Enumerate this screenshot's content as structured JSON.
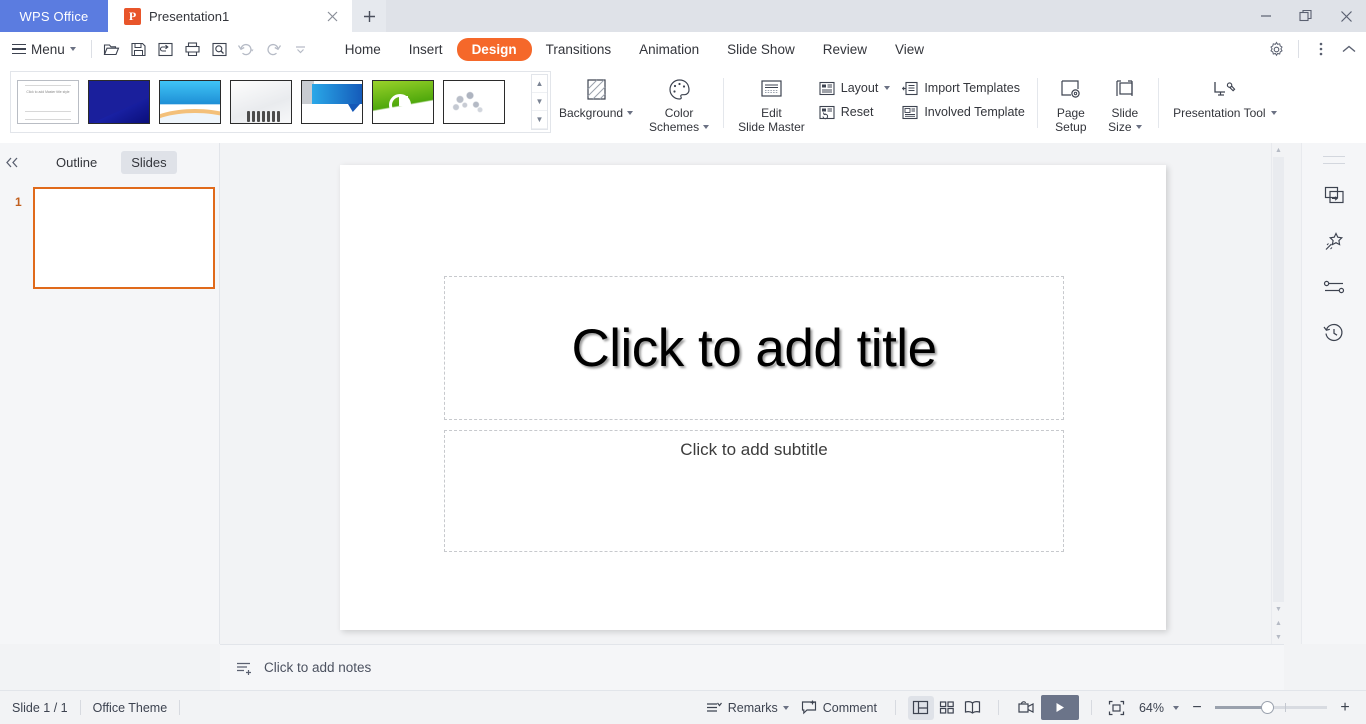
{
  "titlebar": {
    "app_name": "WPS Office",
    "doc_tab": {
      "title": "Presentation1",
      "icon": "powerpoint-icon",
      "icon_glyph": "P",
      "close_icon": "close-icon"
    },
    "new_tab_label": "+",
    "window_controls": {
      "minimize": "minimize-icon",
      "restore": "restore-icon",
      "close": "close-icon"
    }
  },
  "menubar": {
    "menu_label": "Menu",
    "quick_access": [
      "open-icon",
      "save-icon",
      "save-as-icon",
      "print-icon",
      "print-preview-icon",
      "undo-icon",
      "redo-icon",
      "customize-qat-icon"
    ],
    "tabs": [
      {
        "label": "Home",
        "active": false
      },
      {
        "label": "Insert",
        "active": false
      },
      {
        "label": "Design",
        "active": true
      },
      {
        "label": "Transitions",
        "active": false
      },
      {
        "label": "Animation",
        "active": false
      },
      {
        "label": "Slide Show",
        "active": false
      },
      {
        "label": "Review",
        "active": false
      },
      {
        "label": "View",
        "active": false
      }
    ],
    "right_icons": [
      "gear-icon",
      "more-options-icon",
      "collapse-ribbon-icon"
    ],
    "accent_color": "#f5682a"
  },
  "ribbon": {
    "gallery": {
      "name": "design-templates-gallery",
      "templates": [
        {
          "name": "office-theme-blank",
          "master_text": "Click to add Master title style",
          "sub_text": "Click to edit Master subtitle style"
        },
        {
          "name": "blue-gradient-template"
        },
        {
          "name": "sky-wave-template"
        },
        {
          "name": "business-people-template"
        },
        {
          "name": "blue-banner-template"
        },
        {
          "name": "green-pie-template"
        },
        {
          "name": "grey-gears-template"
        }
      ],
      "scroll_buttons": [
        "scroll-up-icon",
        "scroll-down-icon",
        "expand-gallery-icon"
      ]
    },
    "background": {
      "label": "Background",
      "icon": "background-icon",
      "has_dropdown": true
    },
    "color_schemes": {
      "label": "Color\nSchemes",
      "line1": "Color",
      "line2": "Schemes",
      "icon": "palette-icon",
      "has_dropdown": true
    },
    "edit_slide_master": {
      "line1": "Edit",
      "line2": "Slide Master",
      "icon": "slide-master-icon"
    },
    "layout": {
      "label": "Layout",
      "icon": "layout-icon",
      "has_dropdown": true
    },
    "reset": {
      "label": "Reset",
      "icon": "reset-icon"
    },
    "import_templates": {
      "label": "Import Templates",
      "icon": "import-templates-icon"
    },
    "involved_template": {
      "label": "Involved Template",
      "icon": "involved-template-icon"
    },
    "page_setup": {
      "line1": "Page",
      "line2": "Setup",
      "icon": "page-setup-icon"
    },
    "slide_size": {
      "line1": "Slide",
      "line2": "Size",
      "icon": "slide-size-icon",
      "has_dropdown": true
    },
    "presentation_tool": {
      "label": "Presentation Tool",
      "icon": "presentation-tool-icon",
      "has_dropdown": true
    }
  },
  "left_panel": {
    "collapse_icon": "collapse-panel-icon",
    "tabs": [
      {
        "label": "Outline",
        "active": false
      },
      {
        "label": "Slides",
        "active": true
      }
    ],
    "slides": [
      {
        "number": "1",
        "selected": true
      }
    ],
    "selection_color": "#e06a1b"
  },
  "slide": {
    "title_placeholder": "Click to add title",
    "subtitle_placeholder": "Click to add subtitle"
  },
  "notes": {
    "placeholder": "Click to add notes",
    "icon": "add-notes-icon"
  },
  "right_rail": {
    "icons": [
      "grip-handle",
      "slide-transition-icon",
      "magic-wand-icon",
      "settings-sliders-icon",
      "history-icon"
    ]
  },
  "statusbar": {
    "slide_count": "Slide 1 / 1",
    "theme": "Office Theme",
    "remarks": {
      "label": "Remarks",
      "icon": "remarks-icon",
      "has_dropdown": true
    },
    "comment": {
      "label": "Comment",
      "icon": "comment-icon"
    },
    "view_modes": [
      {
        "name": "normal-view",
        "icon": "normal-view-icon",
        "active": true
      },
      {
        "name": "slide-sorter-view",
        "icon": "slide-sorter-icon",
        "active": false
      },
      {
        "name": "reading-view",
        "icon": "reading-view-icon",
        "active": false
      }
    ],
    "record": {
      "icon": "record-screen-icon"
    },
    "play": {
      "icon": "play-slideshow-icon"
    },
    "fit_slide": {
      "icon": "fit-to-window-icon"
    },
    "zoom_level": "64%",
    "zoom_out_label": "−",
    "zoom_in_label": "+"
  }
}
